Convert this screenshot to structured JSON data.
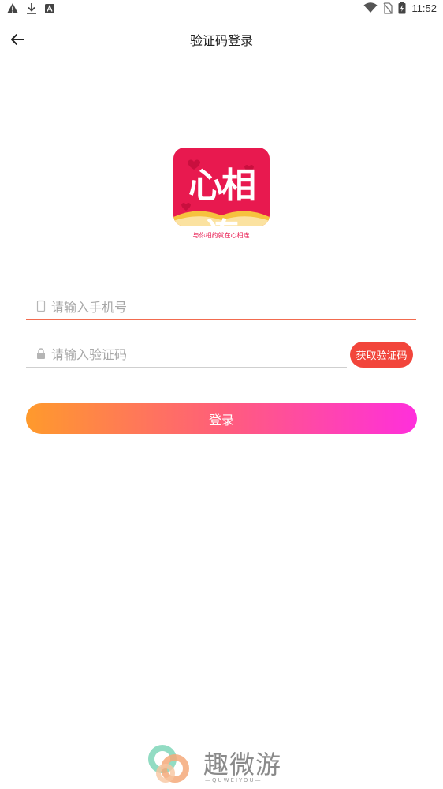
{
  "status_bar": {
    "time": "11:52",
    "left_icons": [
      "warning-icon",
      "download-icon",
      "app-notification-icon"
    ],
    "right_icons": [
      "wifi-icon",
      "no-sim-icon",
      "battery-icon"
    ]
  },
  "header": {
    "title": "验证码登录",
    "back_icon": "back-arrow-icon"
  },
  "logo": {
    "text": "心相连",
    "tagline": "与你相约就在心相连",
    "brand_color": "#e8194f"
  },
  "form": {
    "phone": {
      "placeholder": "请输入手机号",
      "value": "",
      "icon": "phone-icon"
    },
    "code": {
      "placeholder": "请输入验证码",
      "value": "",
      "icon": "lock-icon"
    },
    "get_code_label": "获取验证码",
    "login_label": "登录"
  },
  "watermark": {
    "name": "趣微游",
    "sub": "—QUWEIYOU—"
  },
  "colors": {
    "accent_red": "#f2453b",
    "gradient_start": "#ff9a2c",
    "gradient_end": "#ff2fdc",
    "underline_active": "#f26b4f"
  }
}
